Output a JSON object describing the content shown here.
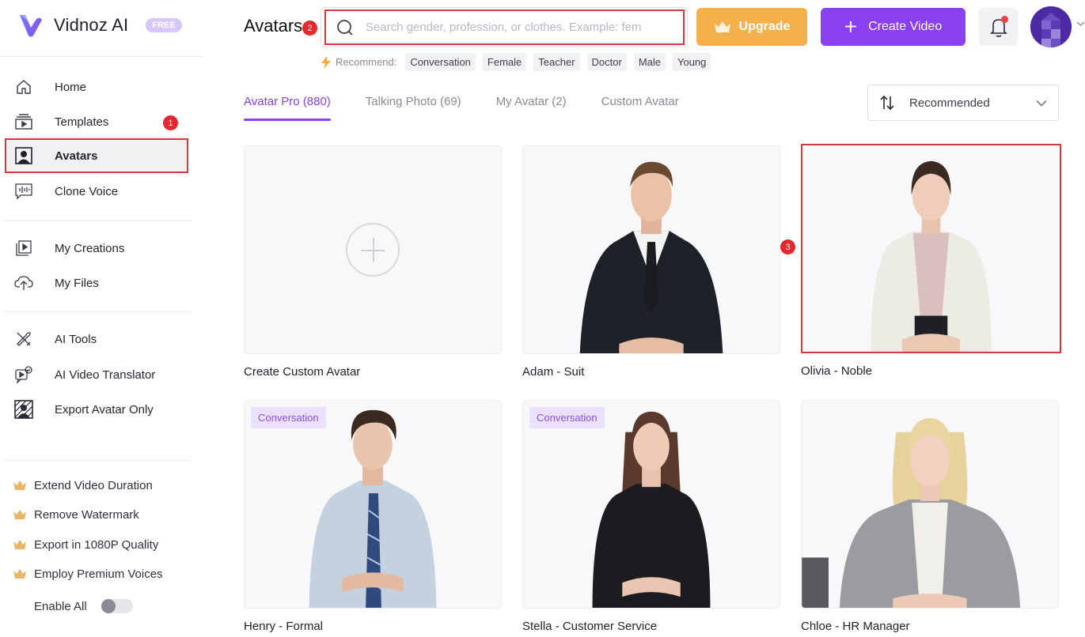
{
  "app": {
    "name": "Vidnoz AI",
    "plan_badge": "FREE"
  },
  "sidebar": {
    "nav_group_1": [
      {
        "label": "Home",
        "icon": "home-icon"
      },
      {
        "label": "Templates",
        "icon": "templates-icon",
        "marker": "1"
      },
      {
        "label": "Avatars",
        "icon": "avatar-icon",
        "active": true
      },
      {
        "label": "Clone Voice",
        "icon": "voice-icon"
      }
    ],
    "nav_group_2": [
      {
        "label": "My Creations",
        "icon": "creations-icon"
      },
      {
        "label": "My Files",
        "icon": "upload-cloud-icon"
      }
    ],
    "nav_group_3": [
      {
        "label": "AI Tools",
        "icon": "tools-icon"
      },
      {
        "label": "AI Video Translator",
        "icon": "translator-icon"
      },
      {
        "label": "Export Avatar Only",
        "icon": "export-avatar-icon"
      }
    ],
    "perks": [
      {
        "label": "Extend Video Duration",
        "icon": "crown-icon"
      },
      {
        "label": "Remove Watermark",
        "icon": "crown-icon"
      },
      {
        "label": "Export in 1080P Quality",
        "icon": "crown-icon"
      },
      {
        "label": "Employ Premium Voices",
        "icon": "crown-icon"
      }
    ],
    "enable_all": {
      "label": "Enable All",
      "on": false
    }
  },
  "header": {
    "title": "Avatars",
    "title_marker": "2",
    "search": {
      "placeholder": "Search gender, profession, or clothes. Example: fem",
      "value": ""
    },
    "recommend_label": "Recommend:",
    "recommend_chips": [
      "Conversation",
      "Female",
      "Teacher",
      "Doctor",
      "Male",
      "Young"
    ],
    "upgrade_label": "Upgrade",
    "create_video_label": "Create Video",
    "notification_unread": true
  },
  "tabs": [
    {
      "label": "Avatar Pro (880)",
      "active": true
    },
    {
      "label": "Talking Photo (69)",
      "active": false
    },
    {
      "label": "My Avatar (2)",
      "active": false
    },
    {
      "label": "Custom Avatar",
      "active": false
    }
  ],
  "sort": {
    "label": "Recommended"
  },
  "grid_marker": "3",
  "avatars": [
    {
      "name": "Create Custom Avatar",
      "type": "create"
    },
    {
      "name": "Adam - Suit",
      "tag": null
    },
    {
      "name": "Olivia - Noble",
      "tag": null,
      "highlighted": true
    },
    {
      "name": "Henry - Formal",
      "tag": "Conversation"
    },
    {
      "name": "Stella - Customer Service",
      "tag": "Conversation"
    },
    {
      "name": "Chloe - HR Manager",
      "tag": null
    }
  ],
  "colors": {
    "brand_purple": "#8a3ff0",
    "upgrade_orange": "#f4b04a",
    "highlight_red": "#d5393f",
    "tag_bg": "#ebe0fd"
  }
}
